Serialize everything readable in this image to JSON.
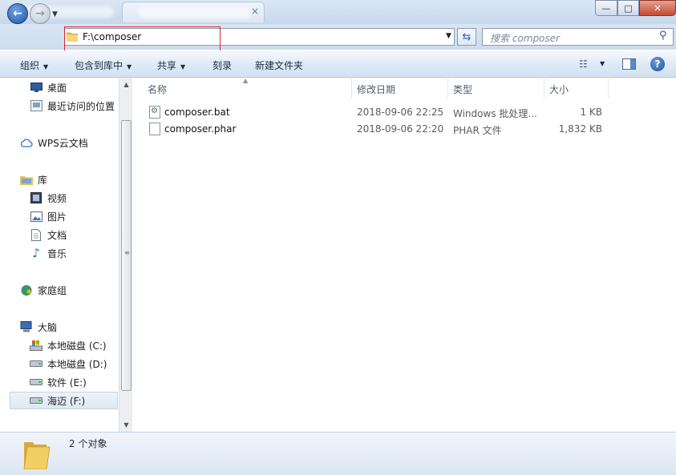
{
  "address": {
    "path": "F:\\composer"
  },
  "search": {
    "placeholder": "搜索 composer"
  },
  "toolbar": {
    "organize": "组织",
    "include_library": "包含到库中",
    "share": "共享",
    "burn": "刻录",
    "new_folder": "新建文件夹"
  },
  "nav": {
    "desktop": "桌面",
    "recent": "最近访问的位置",
    "wps": "WPS云文档",
    "libraries": "库",
    "videos": "视频",
    "pictures": "图片",
    "documents": "文档",
    "music": "音乐",
    "homegroup": "家庭组",
    "computer": "大脑",
    "drive_c": "本地磁盘 (C:)",
    "drive_d": "本地磁盘 (D:)",
    "drive_e": "软件 (E:)",
    "drive_f": "海迈 (F:)"
  },
  "columns": {
    "name": "名称",
    "modified": "修改日期",
    "type": "类型",
    "size": "大小"
  },
  "files": [
    {
      "name": "composer.bat",
      "modified": "2018-09-06 22:25",
      "type": "Windows 批处理...",
      "size": "1 KB",
      "icon": "batch-file-icon"
    },
    {
      "name": "composer.phar",
      "modified": "2018-09-06 22:20",
      "type": "PHAR 文件",
      "size": "1,832 KB",
      "icon": "generic-file-icon"
    }
  ],
  "status": {
    "count": "2 个对象"
  },
  "colors": {
    "titlebar": "#c6d8ec",
    "selection": "#dfe8f2",
    "address_highlight": "#d9262c",
    "close_button": "#c44a33"
  }
}
